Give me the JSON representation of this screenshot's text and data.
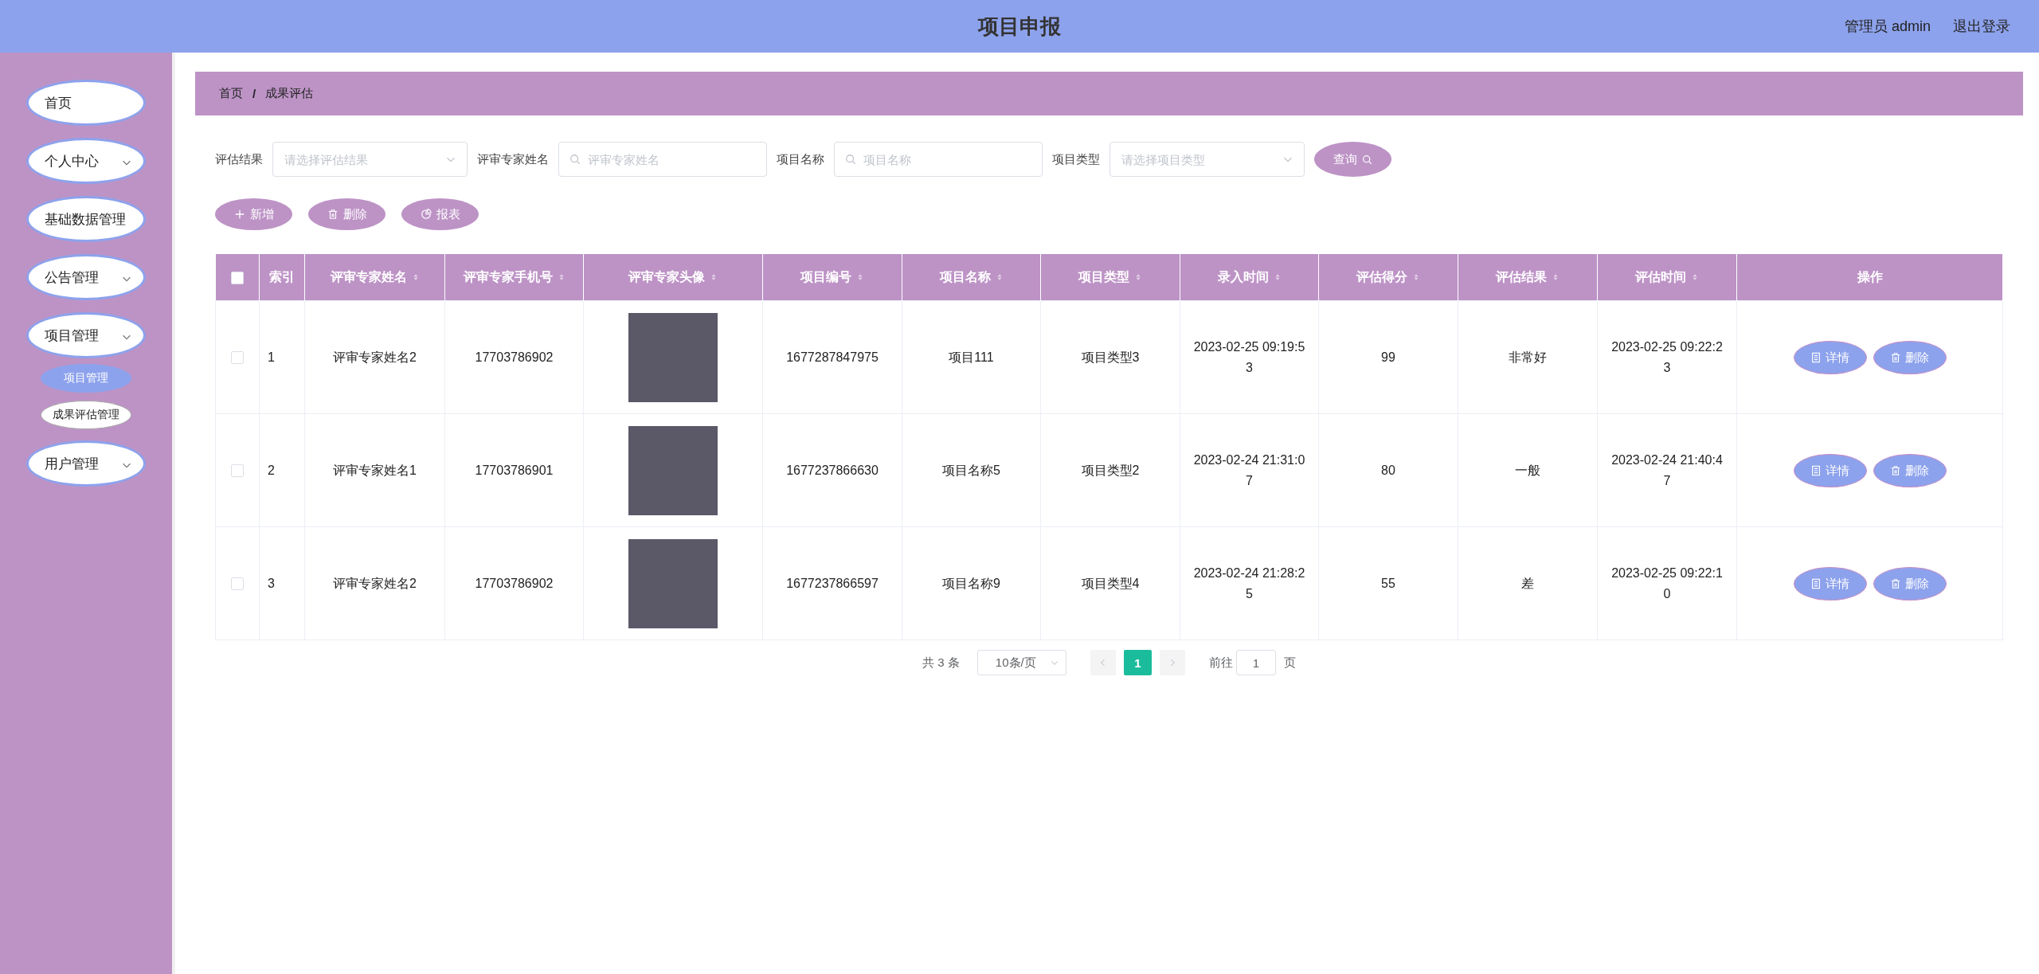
{
  "header": {
    "title": "项目申报",
    "user": "管理员 admin",
    "logout": "退出登录"
  },
  "sidebar": {
    "items": [
      {
        "label": "首页",
        "kind": "link"
      },
      {
        "label": "个人中心",
        "kind": "submenu"
      },
      {
        "label": "基础数据管理",
        "kind": "link"
      },
      {
        "label": "公告管理",
        "kind": "submenu"
      },
      {
        "label": "项目管理",
        "kind": "submenu",
        "children": [
          {
            "label": "项目管理",
            "selected": true
          },
          {
            "label": "成果评估管理",
            "selected": false
          }
        ]
      },
      {
        "label": "用户管理",
        "kind": "submenu"
      }
    ]
  },
  "breadcrumb": {
    "items": [
      "首页",
      "成果评估"
    ],
    "separator": "/"
  },
  "filters": [
    {
      "label": "评估结果",
      "kind": "select",
      "placeholder": "请选择评估结果"
    },
    {
      "label": "评审专家姓名",
      "kind": "search",
      "placeholder": "评审专家姓名"
    },
    {
      "label": "项目名称",
      "kind": "search",
      "placeholder": "项目名称"
    },
    {
      "label": "项目类型",
      "kind": "select",
      "placeholder": "请选择项目类型"
    }
  ],
  "search_button": "查询",
  "actions": [
    {
      "label": "新增",
      "kind": "add"
    },
    {
      "label": "删除",
      "kind": "delete"
    },
    {
      "label": "报表",
      "kind": "report"
    }
  ],
  "table": {
    "select_all": {
      "checked": false
    },
    "columns": [
      {
        "label": "索引",
        "sortable": false
      },
      {
        "label": "评审专家姓名",
        "sortable": true
      },
      {
        "label": "评审专家手机号",
        "sortable": true
      },
      {
        "label": "评审专家头像",
        "sortable": true
      },
      {
        "label": "项目编号",
        "sortable": true
      },
      {
        "label": "项目名称",
        "sortable": true
      },
      {
        "label": "项目类型",
        "sortable": true
      },
      {
        "label": "录入时间",
        "sortable": true
      },
      {
        "label": "评估得分",
        "sortable": true
      },
      {
        "label": "评估结果",
        "sortable": true
      },
      {
        "label": "评估时间",
        "sortable": true
      },
      {
        "label": "操作",
        "sortable": false
      }
    ],
    "rows": [
      {
        "checked": false,
        "cells": [
          "1",
          "评审专家姓名2",
          "17703786902",
          null,
          "1677287847975",
          "项目111",
          "项目类型3",
          "2023-02-25 09:19:53",
          "99",
          "非常好",
          "2023-02-25 09:22:23"
        ],
        "actions": [
          {
            "label": "详情",
            "kind": "detail"
          },
          {
            "label": "删除",
            "kind": "delete"
          }
        ]
      },
      {
        "checked": false,
        "cells": [
          "2",
          "评审专家姓名1",
          "17703786901",
          null,
          "1677237866630",
          "项目名称5",
          "项目类型2",
          "2023-02-24 21:31:07",
          "80",
          "一般",
          "2023-02-24 21:40:47"
        ],
        "actions": [
          {
            "label": "详情",
            "kind": "detail"
          },
          {
            "label": "删除",
            "kind": "delete"
          }
        ]
      },
      {
        "checked": false,
        "cells": [
          "3",
          "评审专家姓名2",
          "17703786902",
          null,
          "1677237866597",
          "项目名称9",
          "项目类型4",
          "2023-02-24 21:28:25",
          "55",
          "差",
          "2023-02-25 09:22:10"
        ],
        "actions": [
          {
            "label": "详情",
            "kind": "detail"
          },
          {
            "label": "删除",
            "kind": "delete"
          }
        ]
      }
    ]
  },
  "pager": {
    "total": "共 3 条",
    "page_size": "10条/页",
    "pages": [
      {
        "label": "1",
        "selected": true
      }
    ],
    "goto_label": "前往",
    "goto_value": "1",
    "goto_suffix": "页"
  }
}
